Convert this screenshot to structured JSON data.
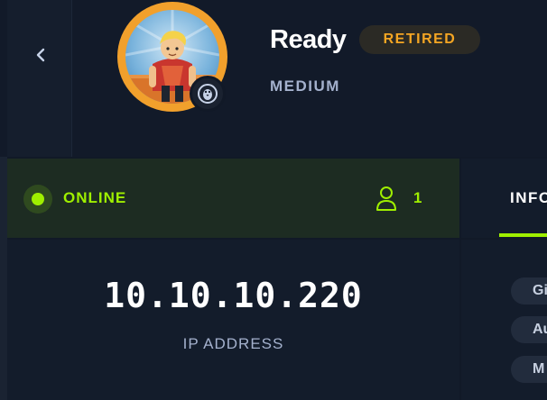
{
  "machine": {
    "name": "Ready",
    "status": "RETIRED",
    "difficulty": "MEDIUM",
    "os_icon": "linux-penguin-icon"
  },
  "connection": {
    "status": "ONLINE",
    "players": "1"
  },
  "tabs": [
    {
      "label": "INFO"
    }
  ],
  "network": {
    "ip": "10.10.10.220",
    "ip_label": "IP ADDRESS"
  },
  "chips": [
    {
      "label": "Gi"
    },
    {
      "label": "Au"
    },
    {
      "label": "M"
    }
  ],
  "colors": {
    "accent": "#9fef00",
    "retired": "#f5a623",
    "background": "#111927"
  }
}
